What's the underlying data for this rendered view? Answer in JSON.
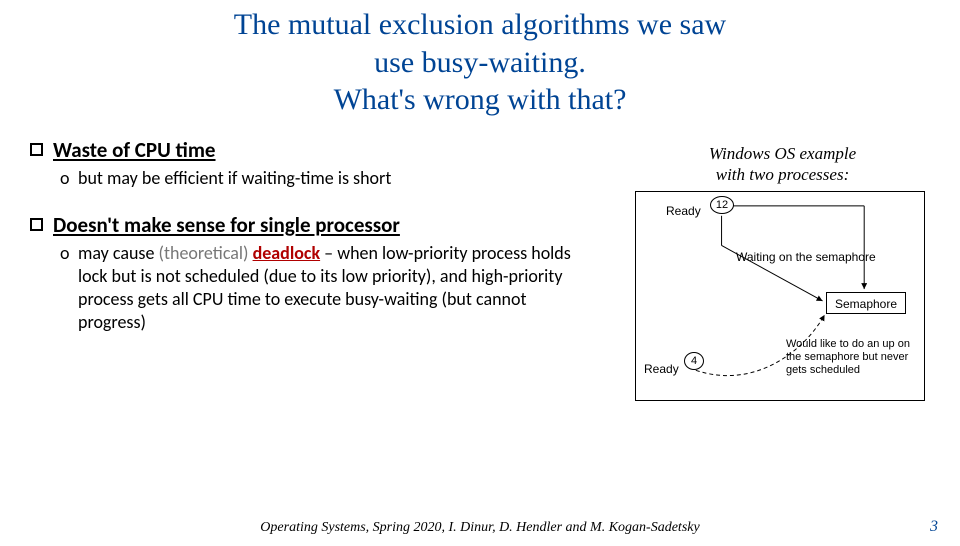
{
  "title": {
    "l1": "The mutual exclusion algorithms we saw",
    "l2": "use busy-waiting.",
    "l3": "What's wrong with that?"
  },
  "bullets": {
    "b1": "Waste of CPU time",
    "b1sub": "but may be efficient if waiting-time is short",
    "b2": "Doesn't make sense for single processor",
    "b2sub_pre": "may cause ",
    "b2sub_theo": "(theoretical) ",
    "b2sub_dead": "deadlock",
    "b2sub_post": " – when low-priority process holds lock but is not scheduled (due to its low priority), and high-priority process gets all CPU time to execute busy-waiting (but cannot progress)"
  },
  "figure": {
    "caption_l1": "Windows OS example",
    "caption_l2": "with two processes:",
    "ready1": "Ready",
    "id1": "12",
    "waiting": "Waiting on the semaphore",
    "sem": "Semaphore",
    "ready2": "Ready",
    "id2": "4",
    "note": "Would like to do an up on the semaphore but never gets scheduled"
  },
  "footer": "Operating Systems, Spring 2020, I. Dinur, D. Hendler and M. Kogan-Sadetsky",
  "page": "3"
}
